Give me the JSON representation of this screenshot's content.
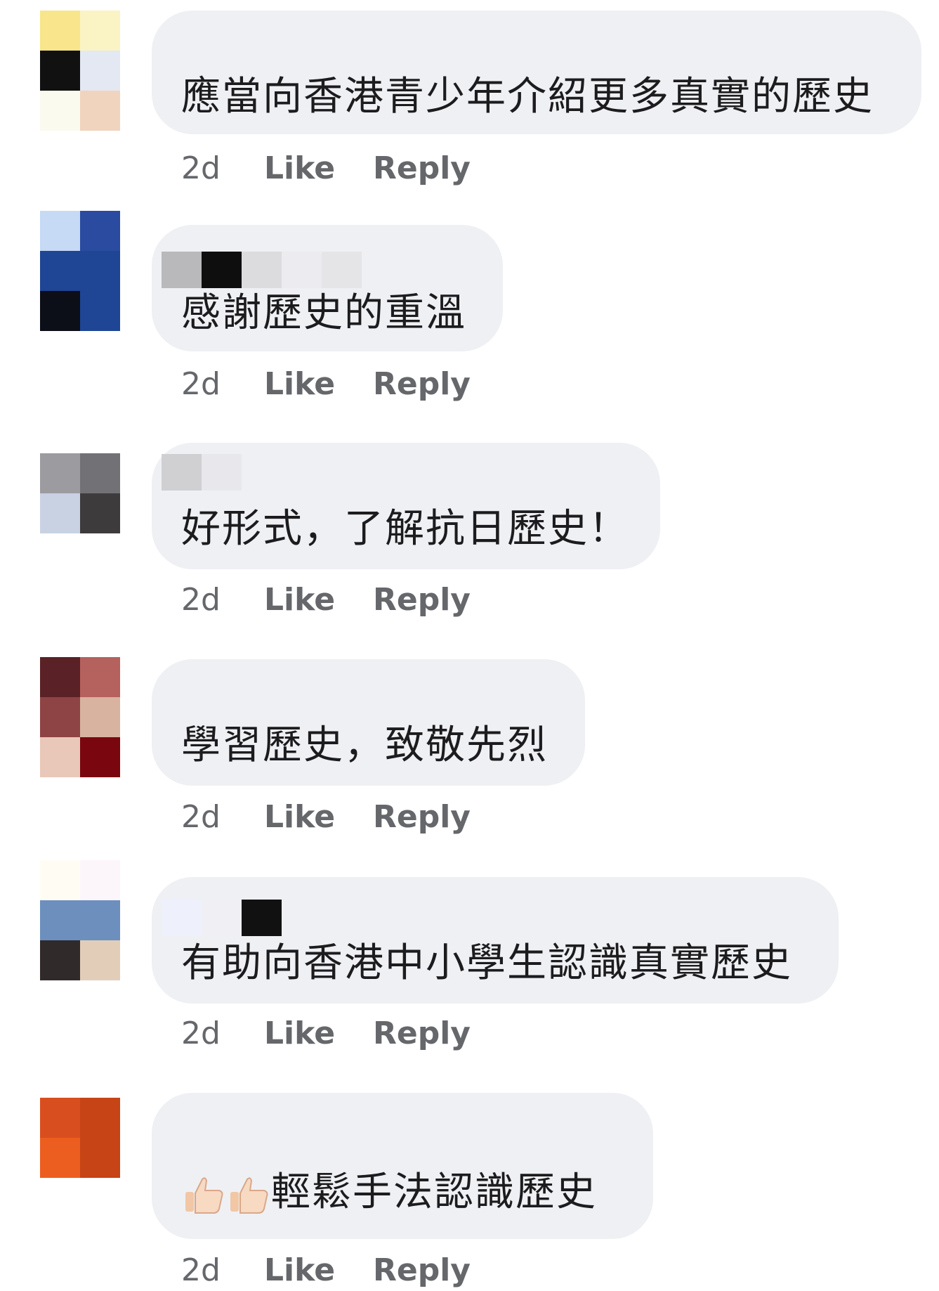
{
  "comments": [
    {
      "text": "應當向香港青少年介紹更多真實的歷史",
      "time": "2d",
      "like": "Like",
      "reply": "Reply"
    },
    {
      "text": "感謝歷史的重溫",
      "time": "2d",
      "like": "Like",
      "reply": "Reply"
    },
    {
      "text": "好形式，了解抗日歷史！",
      "time": "2d",
      "like": "Like",
      "reply": "Reply"
    },
    {
      "text": "學習歷史，致敬先烈",
      "time": "2d",
      "like": "Like",
      "reply": "Reply"
    },
    {
      "text": "有助向香港中小學生認識真實歷史",
      "time": "2d",
      "like": "Like",
      "reply": "Reply"
    },
    {
      "text": "輕鬆手法認識歷史",
      "time": "2d",
      "like": "Like",
      "reply": "Reply",
      "emoji_prefix": "thumbs-up-icon x2"
    }
  ],
  "colors": {
    "bubble": "#eff0f3",
    "action": "#65676b",
    "text": "#1c1c1e"
  }
}
